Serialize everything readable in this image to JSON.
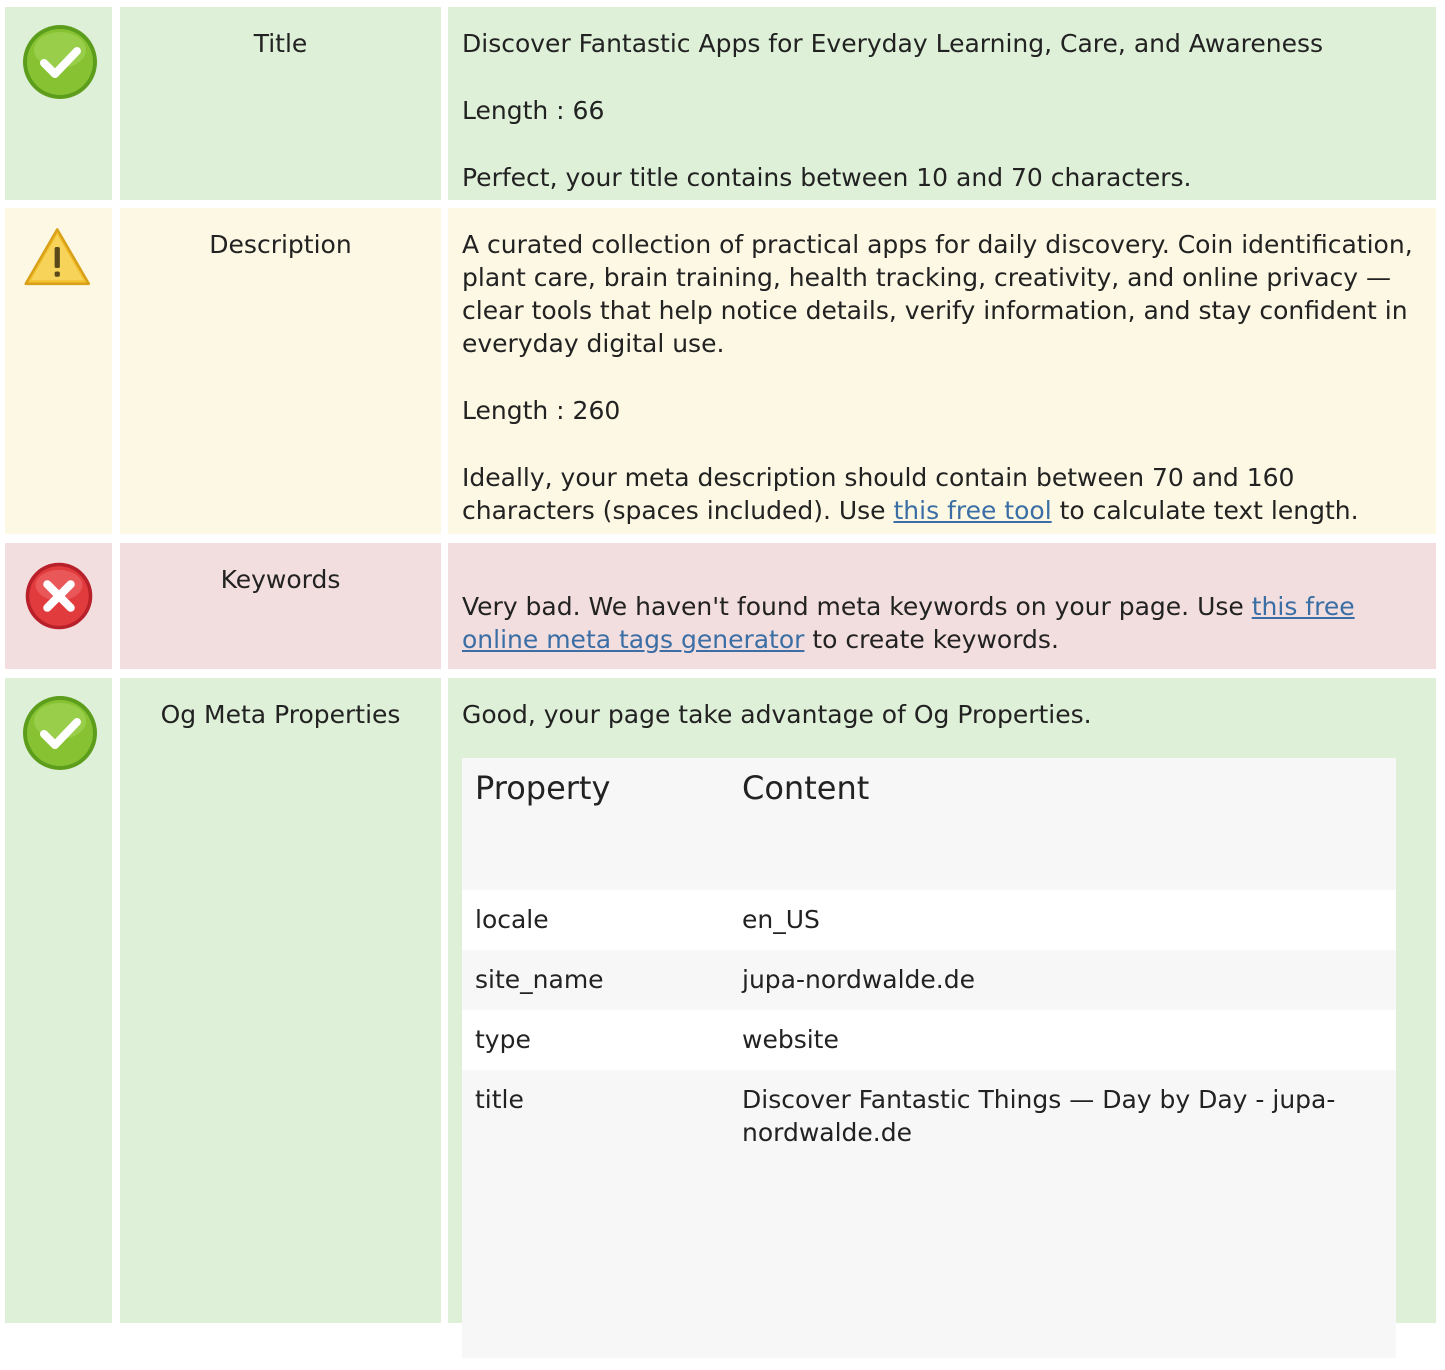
{
  "title_row": {
    "label": "Title",
    "title_text": "Discover Fantastic Apps for Everyday Learning, Care, and Awareness",
    "length_text": "Length : 66",
    "verdict": "Perfect, your title contains between 10 and 70 characters.",
    "status_icon": "check-icon",
    "status_color": "#7cbb2a"
  },
  "description_row": {
    "label": "Description",
    "description_text": "A curated collection of practical apps for daily discovery. Coin identification, plant care, brain training, health tracking, creativity, and online privacy — clear tools that help notice details, verify information, and stay confident in everyday digital use.",
    "length_text": "Length : 260",
    "verdict_before": "Ideally, your meta description should contain between 70 and 160 characters (spaces included). Use ",
    "verdict_link": "this free tool",
    "verdict_after": " to calculate text length.",
    "status_icon": "warning-icon",
    "status_color": "#f2c02a"
  },
  "keywords_row": {
    "label": "Keywords",
    "verdict_before": "Very bad. We haven't found meta keywords on your page. Use ",
    "verdict_link": "this free online meta tags generator",
    "verdict_after": " to create keywords.",
    "status_icon": "error-icon",
    "status_color": "#e0393b"
  },
  "og_row": {
    "label": "Og Meta Properties",
    "verdict": "Good, your page take advantage of Og Properties.",
    "status_icon": "check-icon",
    "table": {
      "header_property": "Property",
      "header_content": "Content",
      "rows": [
        {
          "property": "locale",
          "content": "en_US"
        },
        {
          "property": "site_name",
          "content": "jupa-nordwalde.de"
        },
        {
          "property": "type",
          "content": "website"
        },
        {
          "property": "title",
          "content": "Discover Fantastic Things — Day by Day - jupa-nordwalde.de"
        }
      ]
    }
  },
  "colors": {
    "good_bg": "#dff0d8",
    "warn_bg": "#fcf8e3",
    "bad_bg": "#f2dede",
    "link": "#3a6ea5"
  }
}
